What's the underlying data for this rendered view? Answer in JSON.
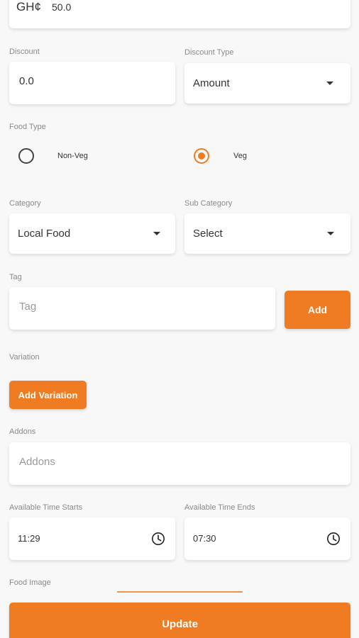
{
  "price": {
    "currency": "GH¢",
    "value": "50.0"
  },
  "discount": {
    "label": "Discount",
    "value": "0.0"
  },
  "discount_type": {
    "label": "Discount Type",
    "selected": "Amount"
  },
  "food_type": {
    "label": "Food Type",
    "options": [
      "Non-Veg",
      "Veg"
    ],
    "selected": "Veg"
  },
  "category": {
    "label": "Category",
    "selected": "Local Food"
  },
  "sub_category": {
    "label": "Sub Category",
    "selected": "Select"
  },
  "tag": {
    "label": "Tag",
    "placeholder": "Tag",
    "add_label": "Add"
  },
  "variation": {
    "label": "Variation",
    "button_label": "Add Variation"
  },
  "addons": {
    "label": "Addons",
    "placeholder": "Addons"
  },
  "time_start": {
    "label": "Available Time Starts",
    "value": "11:29"
  },
  "time_end": {
    "label": "Available Time Ends",
    "value": "07:30"
  },
  "food_image": {
    "label": "Food Image"
  },
  "update_label": "Update",
  "colors": {
    "accent": "#ef7b22",
    "background": "#f8f8f8"
  }
}
